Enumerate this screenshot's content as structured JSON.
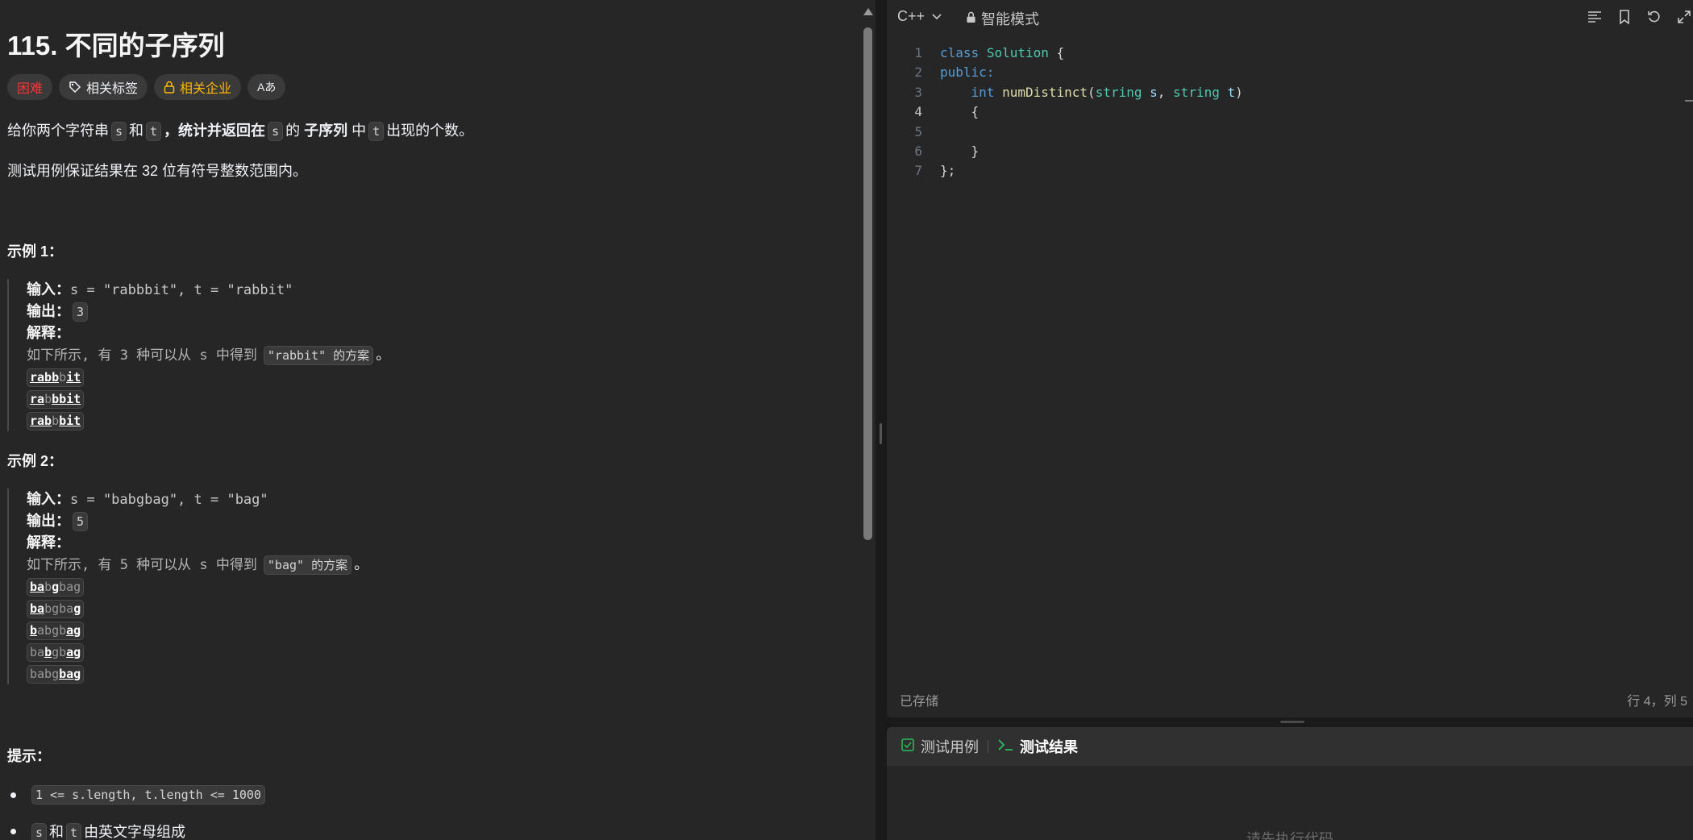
{
  "problem": {
    "title": "115. 不同的子序列",
    "tags": {
      "difficulty": "困难",
      "related_tags": "相关标签",
      "related_companies": "相关企业",
      "font_icon_label": "Aあ"
    },
    "desc1": {
      "p1": "给你两个字符串",
      "s": "s",
      "p2": "和",
      "t": "t",
      "p3": "，统计并返回在",
      "s2": "s",
      "p4": "的",
      "bold": "子序列",
      "p5": "中",
      "t2": "t",
      "p6": "出现的个数。"
    },
    "desc2": "测试用例保证结果在 32 位有符号整数范围内。",
    "example1": {
      "heading": "示例 1：",
      "input_label": "输入：",
      "input_value": "s = \"rabbbit\", t = \"rabbit\"",
      "output_label": "输出：",
      "output_value": "3",
      "explain_label": "解释：",
      "explain_pre": "如下所示, 有 3 种可以从 s 中得到",
      "explain_chip": "\"rabbit\" 的方案",
      "explain_post": "。"
    },
    "example2": {
      "heading": "示例 2：",
      "input_label": "输入：",
      "input_value": "s = \"babgbag\", t = \"bag\"",
      "output_label": "输出：",
      "output_value": "5",
      "explain_label": "解释：",
      "explain_pre": "如下所示, 有 5 种可以从 s 中得到",
      "explain_chip": "\"bag\" 的方案",
      "explain_post": "。"
    },
    "hints": {
      "heading": "提示：",
      "item1": "1 <= s.length, t.length <= 1000",
      "item2_s": "s",
      "item2_and": "和",
      "item2_t": "t",
      "item2_rest": "由英文字母组成"
    }
  },
  "editor": {
    "language": "C++",
    "mode": "智能模式",
    "status_left": "已存储",
    "status_right": "行 4，列 5",
    "line_numbers": [
      "1",
      "2",
      "3",
      "4",
      "5",
      "6",
      "7"
    ],
    "code": {
      "l1_kw": "class",
      "l1_name": "Solution",
      "l1_rest": " {",
      "l2": "public:",
      "l3_int": "int",
      "l3_fn": "numDistinct",
      "l3_p1": "(",
      "l3_ty1": "string",
      "l3_s": "s",
      "l3_comma": ", ",
      "l3_ty2": "string",
      "l3_t": "t",
      "l3_close": ")",
      "l4": "{",
      "l6": "}",
      "l7": "};"
    }
  },
  "tests": {
    "tab_cases": "测试用例",
    "tab_results": "测试结果",
    "placeholder": "请先执行代码"
  },
  "icons": {
    "tag": "tag-icon",
    "lock": "lock-icon",
    "translate": "translate-icon",
    "chevron": "chevron-down-icon",
    "format": "format-icon",
    "bookmark": "bookmark-icon",
    "reset": "reset-icon",
    "expand": "expand-icon",
    "check": "checkbox-icon",
    "terminal": "terminal-icon"
  },
  "colors": {
    "hard": "#f63636",
    "company": "#ffb800",
    "check_green": "#2cbb5d"
  }
}
